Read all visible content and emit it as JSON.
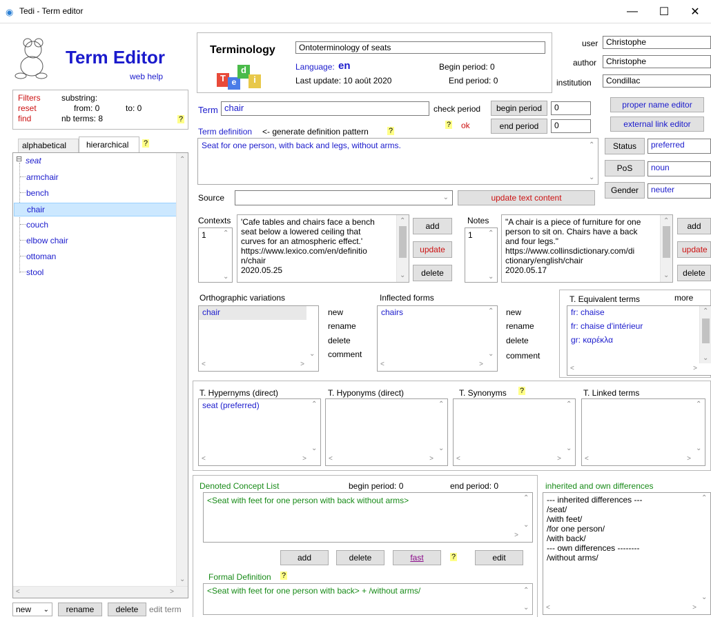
{
  "window": {
    "title": "Tedi - Term editor",
    "min": "—",
    "max": "☐",
    "close": "✕"
  },
  "header": {
    "app_title": "Term Editor",
    "web_help": "web help"
  },
  "filters": {
    "filters": "Filters",
    "reset": "reset",
    "find": "find",
    "substring": "substring:",
    "from": "from: 0",
    "to": "to: 0",
    "nb_terms": "nb terms: 8",
    "q": "?"
  },
  "tabs": {
    "alphabetical": "alphabetical",
    "hierarchical": "hierarchical",
    "q": "?"
  },
  "tree": {
    "root": "seat",
    "toggle": "⊟",
    "items": [
      "armchair",
      "bench",
      "chair",
      "couch",
      "elbow chair",
      "ottoman",
      "stool"
    ],
    "selected": "chair"
  },
  "bottom_left": {
    "new": "new",
    "rename": "rename",
    "delete": "delete",
    "edit_term": "edit term"
  },
  "terminology": {
    "label": "Terminology",
    "name": "Ontoterminology of seats",
    "language_label": "Language:",
    "language": "en",
    "last_update": "Last update: 10 août 2020",
    "begin_period": "Begin period: 0",
    "end_period": "End period: 0",
    "logo": [
      "T",
      "e",
      "d",
      "i"
    ]
  },
  "user_info": {
    "user_label": "user",
    "user": "Christophe",
    "author_label": "author",
    "author": "Christophe",
    "institution_label": "institution",
    "institution": "Condillac"
  },
  "term": {
    "label": "Term",
    "value": "chair",
    "check_period": "check period",
    "begin_period_btn": "begin period",
    "begin_value": "0",
    "end_period_btn": "end period",
    "end_value": "0",
    "q": "?",
    "ok": "ok"
  },
  "definition": {
    "label": "Term definition",
    "pattern": "<- generate definition pattern",
    "q": "?",
    "text": "Seat for one person, with back and legs, without arms."
  },
  "right_buttons": {
    "proper_name_editor": "proper name editor",
    "external_link_editor": "external link editor"
  },
  "status": {
    "label": "Status",
    "value": "preferred"
  },
  "pos": {
    "label": "PoS",
    "value": "noun"
  },
  "gender": {
    "label": "Gender",
    "value": "neuter"
  },
  "source": {
    "label": "Source",
    "value": "",
    "update_btn": "update text content"
  },
  "contexts": {
    "label": "Contexts",
    "index": "1",
    "text": [
      "'Cafe tables and chairs face a bench",
      "seat below a lowered ceiling that",
      "curves for an atmospheric effect.'",
      "https://www.lexico.com/en/definitio",
      "n/chair",
      "2020.05.25"
    ],
    "add": "add",
    "update": "update",
    "delete": "delete"
  },
  "notes": {
    "label": "Notes",
    "index": "1",
    "text": [
      "\"A chair is a piece of furniture for one",
      "person to sit on. Chairs have a back",
      "and four legs.\"",
      "https://www.collinsdictionary.com/di",
      "ctionary/english/chair",
      "2020.05.17"
    ],
    "add": "add",
    "update": "update",
    "delete": "delete"
  },
  "orthographic": {
    "label": "Orthographic variations",
    "items": [
      "chair"
    ],
    "new": "new",
    "rename": "rename",
    "delete": "delete",
    "comment": "comment"
  },
  "inflected": {
    "label": "Inflected forms",
    "items": [
      "chairs"
    ],
    "new": "new",
    "rename": "rename",
    "delete": "delete",
    "comment": "comment"
  },
  "equivalents": {
    "label": "T. Equivalent terms",
    "more": "more",
    "items": [
      "fr: chaise",
      "fr: chaise d'intérieur",
      "gr: καρέκλα"
    ]
  },
  "relations": {
    "hypernyms_label": "T. Hypernyms (direct)",
    "hypernyms": [
      "seat (preferred)"
    ],
    "hyponyms_label": "T. Hyponyms (direct)",
    "synonyms_label": "T. Synonyms",
    "synonyms_q": "?",
    "linked_label": "T. Linked terms"
  },
  "concepts": {
    "label": "Denoted Concept List",
    "begin": "begin period:  0",
    "end": "end period: 0",
    "items": [
      "<Seat with feet for one person with back without arms>"
    ],
    "add": "add",
    "delete": "delete",
    "fast": "fast",
    "q": "?",
    "edit": "edit"
  },
  "formal": {
    "label": "Formal Definition",
    "q": "?",
    "text": "<Seat with feet for one person with back> + /without arms/"
  },
  "differences": {
    "label": "inherited and own differences",
    "lines": [
      "--- inherited differences ---",
      "/seat/",
      "/with feet/",
      "/for one person/",
      "/with back/",
      "--- own differences --------",
      "/without arms/"
    ]
  },
  "colors": {
    "accent_blue": "#1a1acc",
    "red": "#cc1111",
    "green": "#178a17",
    "selection": "#cce8ff"
  }
}
